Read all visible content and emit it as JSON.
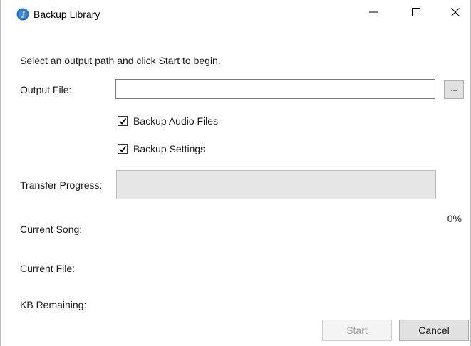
{
  "window": {
    "title": "Backup Library",
    "icon": "app-logo-icon",
    "controls": [
      "minimize-icon",
      "maximize-icon",
      "close-icon"
    ]
  },
  "instructions": "Select an output path and click Start to begin.",
  "output_file": {
    "label": "Output File:",
    "value": "",
    "browse_label": "..."
  },
  "options": {
    "backup_audio": {
      "label": "Backup Audio Files",
      "checked": true
    },
    "backup_settings": {
      "label": "Backup Settings",
      "checked": true
    }
  },
  "progress": {
    "label": "Transfer Progress:",
    "percent_text": "0%",
    "value": 0
  },
  "status": {
    "current_song_label": "Current Song:",
    "current_file_label": "Current File:",
    "kb_remaining_label": "KB Remaining:"
  },
  "buttons": {
    "start": "Start",
    "cancel": "Cancel"
  },
  "colors": {
    "accent": "#2b6fd6",
    "progress_fill": "#06b025"
  }
}
